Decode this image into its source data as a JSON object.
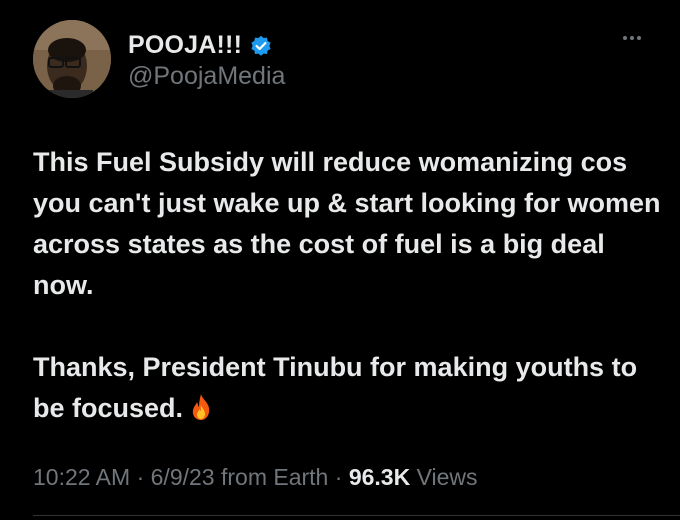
{
  "user": {
    "display_name": "POOJA!!!",
    "handle": "@PoojaMedia",
    "verified": true,
    "verified_color": "#1d9bf0",
    "avatar_icon": "profile-photo"
  },
  "more_icon": "more-dots-icon",
  "tweet": {
    "paragraph1": "This Fuel Subsidy will reduce womanizing cos you can't just wake up & start looking for women across states as the cost of fuel is a big deal now.",
    "paragraph2": "Thanks, President Tinubu for making youths to be focused.",
    "emoji_icon": "fire-emoji-icon"
  },
  "meta": {
    "time": "10:22 AM",
    "sep1": " · ",
    "date": "6/9/23",
    "source": " from Earth",
    "sep2": " · ",
    "views_count": "96.3K",
    "views_label": " Views"
  },
  "colors": {
    "background": "#000000",
    "text": "#e7e9ea",
    "secondary": "#71767b"
  }
}
